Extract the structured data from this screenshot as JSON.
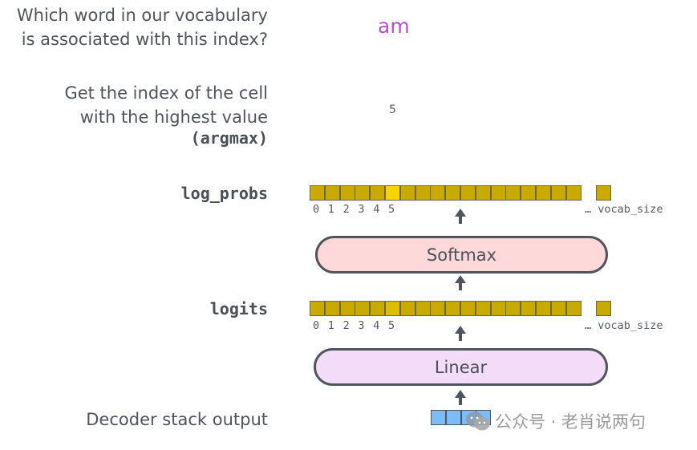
{
  "labels": {
    "question_line1": "Which word in our vocabulary",
    "question_line2": "is associated with this index?",
    "argmax_line1": "Get the index of the cell",
    "argmax_line2": "with the highest value",
    "argmax_line3": "(argmax)",
    "log_probs": "log_probs",
    "logits": "logits",
    "decoder_output": "Decoder stack output"
  },
  "result": {
    "word": "am",
    "index": "5"
  },
  "vectors": {
    "cells_before_ellipsis": 18,
    "highlight_index": 5,
    "tick_labels": [
      "0",
      "1",
      "2",
      "3",
      "4",
      "5"
    ],
    "vocab_label": "… vocab_size",
    "decoder_cells": 4
  },
  "blocks": {
    "softmax": "Softmax",
    "linear": "Linear"
  },
  "colors": {
    "cell": "#c8aa00",
    "log_probs_highlight": "#f6d400",
    "logits_highlight": "#dcbe00",
    "decoder_cell": "#7cbcf8",
    "softmax_fill": "#ffd9d9",
    "linear_fill": "#f3dcf8",
    "word": "#b54fd6"
  },
  "watermark": {
    "text": "公众号 · 老肖说两句",
    "icon": "wechat-icon"
  }
}
